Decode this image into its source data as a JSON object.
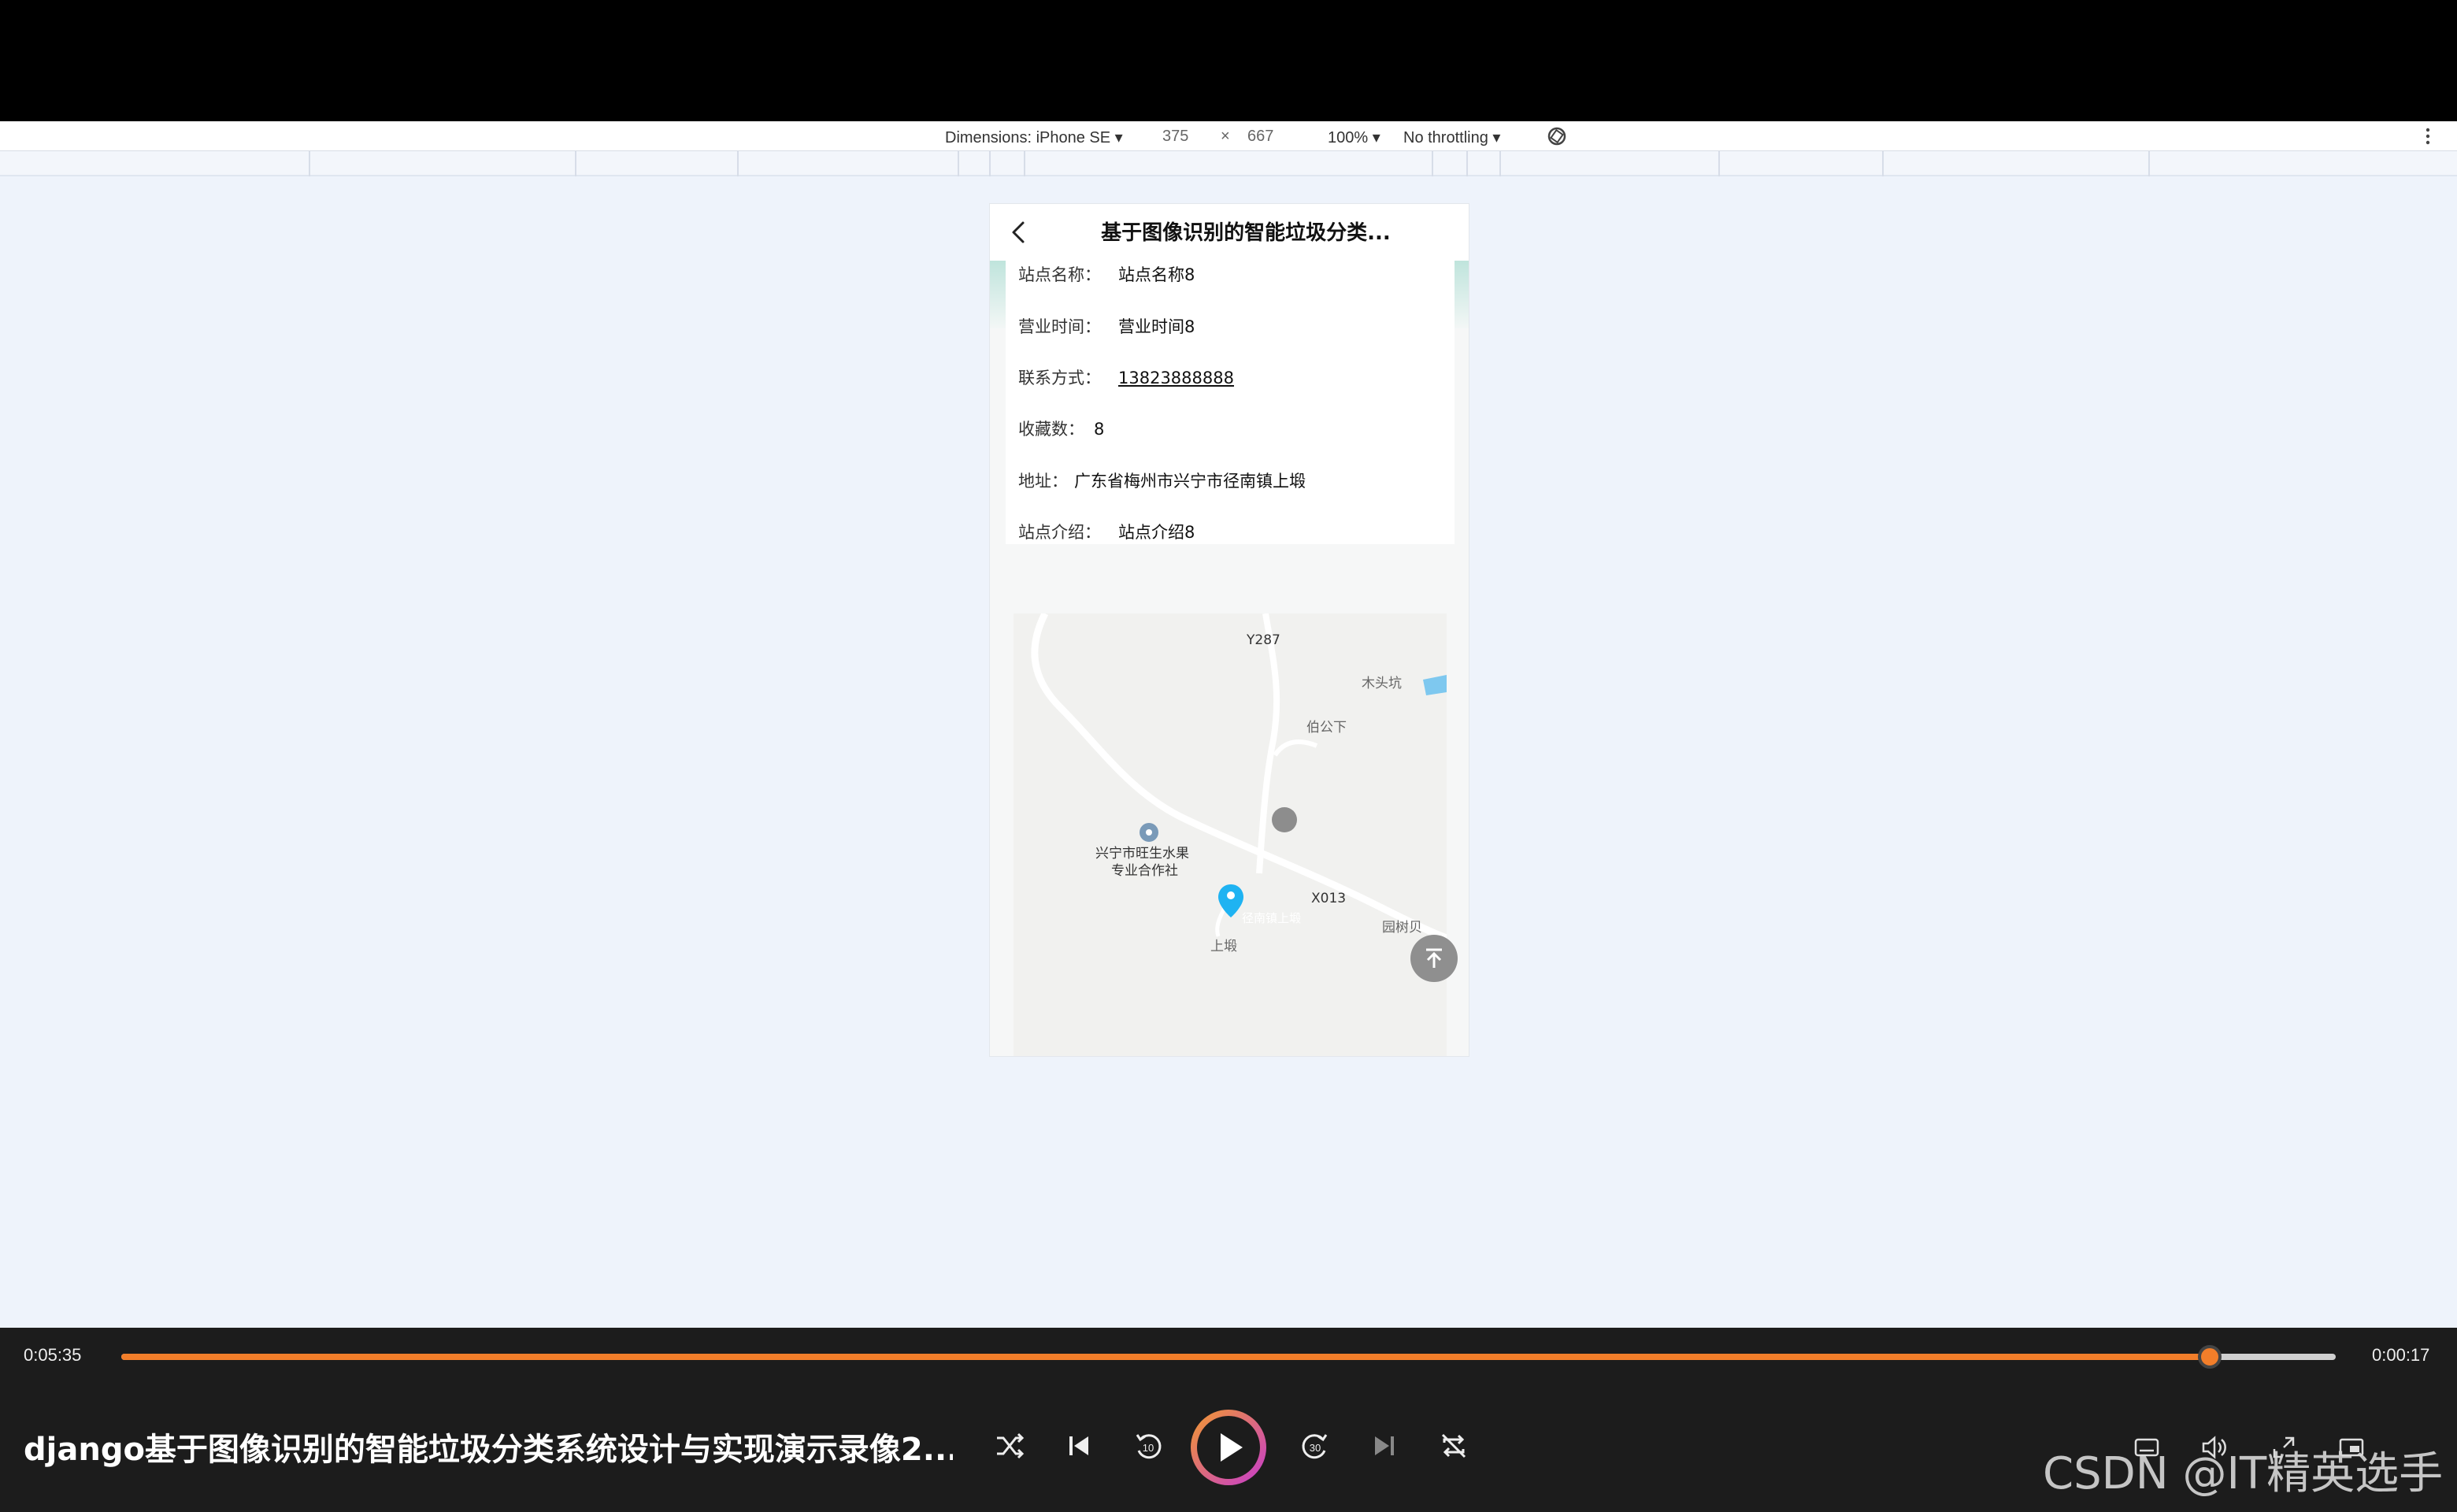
{
  "devtools": {
    "dimensions_label": "Dimensions: iPhone SE ▾",
    "width": "375",
    "times": "×",
    "height": "667",
    "zoom": "100% ▾",
    "throttling": "No throttling ▾"
  },
  "page": {
    "title": "基于图像识别的智能垃圾分类...",
    "info": [
      {
        "label": "站点名称：",
        "value": "站点名称8"
      },
      {
        "label": "营业时间：",
        "value": "营业时间8"
      },
      {
        "label": "联系方式：",
        "value": "13823888888"
      },
      {
        "label": "收藏数：",
        "value": "8"
      },
      {
        "label": "地址：",
        "value": "广东省梅州市兴宁市径南镇上塅"
      },
      {
        "label": "站点介绍：",
        "value": "站点介绍8"
      }
    ],
    "map": {
      "labels": [
        "Y287",
        "木头坑",
        "伯公下",
        "兴宁市旺生水果",
        "专业合作社",
        "X013",
        "园树贝",
        "上塅",
        "径南镇上塅"
      ]
    }
  },
  "player": {
    "current_time": "0:05:35",
    "remaining_time": "0:00:17",
    "progress": 0.943,
    "title": "django基于图像识别的智能垃圾分类系统设计与实现演示录像2...",
    "accent_color": "#f27e2a"
  },
  "watermark": "CSDN @IT精英选手"
}
